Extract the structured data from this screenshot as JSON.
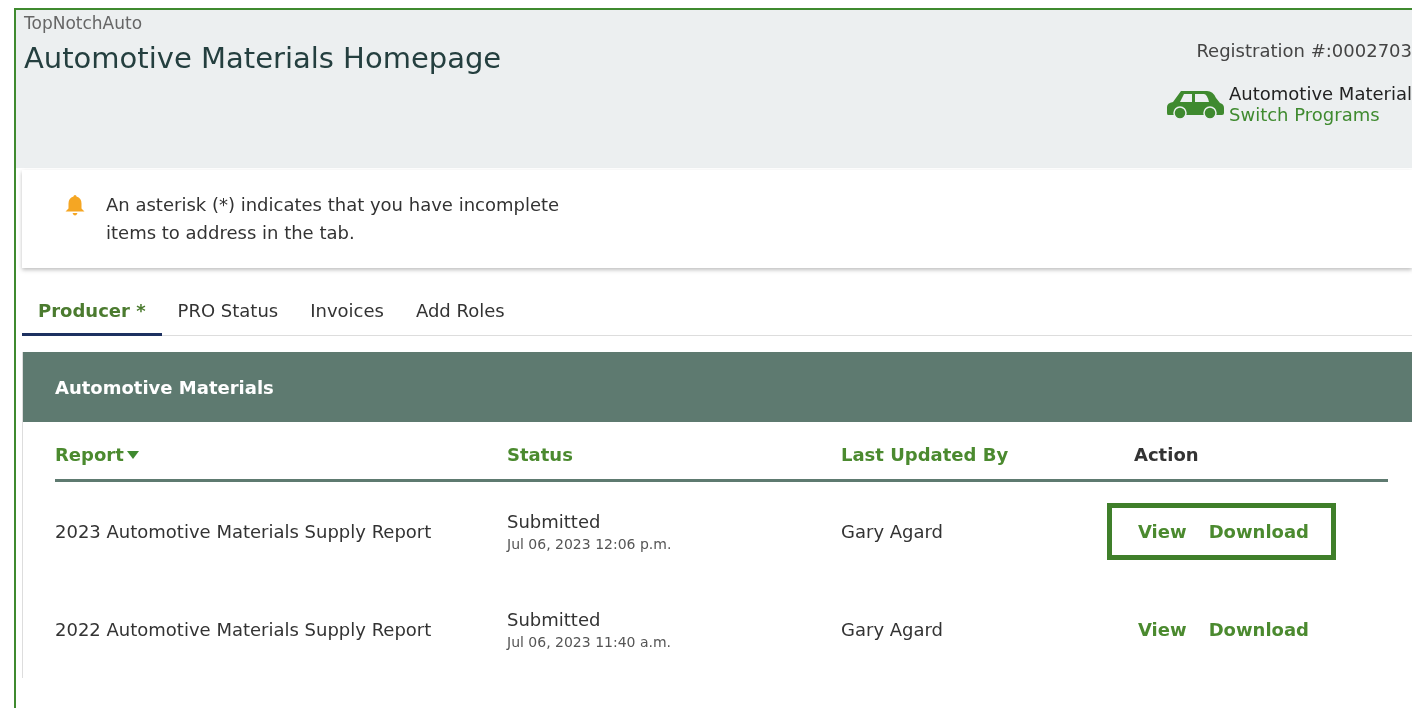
{
  "header": {
    "company": "TopNotchAuto",
    "title": "Automotive Materials Homepage",
    "registration": "Registration #:0002703",
    "program": {
      "name": "Automotive Material",
      "link": "Switch Programs"
    }
  },
  "alert": {
    "text": "An asterisk (*) indicates that you have incomplete items to address in the tab."
  },
  "tabs": [
    {
      "label": "Producer *",
      "selected": true
    },
    {
      "label": "PRO Status",
      "selected": false
    },
    {
      "label": "Invoices",
      "selected": false
    },
    {
      "label": "Add Roles",
      "selected": false
    }
  ],
  "panel": {
    "title": "Automotive Materials",
    "columns": [
      {
        "label": "Report",
        "kind": "link",
        "sorted": true
      },
      {
        "label": "Status",
        "kind": "link",
        "sorted": false
      },
      {
        "label": "Last Updated By",
        "kind": "link",
        "sorted": false
      },
      {
        "label": "Action",
        "kind": "plain",
        "sorted": false
      }
    ],
    "rows": [
      {
        "report": "2023 Automotive Materials Supply Report",
        "status": "Submitted",
        "date": "Jul 06, 2023 12:06 p.m.",
        "updated_by": "Gary Agard",
        "actions": [
          "View",
          "Download"
        ],
        "highlighted": true
      },
      {
        "report": "2022 Automotive Materials Supply Report",
        "status": "Submitted",
        "date": "Jul 06, 2023 11:40 a.m.",
        "updated_by": "Gary Agard",
        "actions": [
          "View",
          "Download"
        ],
        "highlighted": false
      }
    ]
  }
}
